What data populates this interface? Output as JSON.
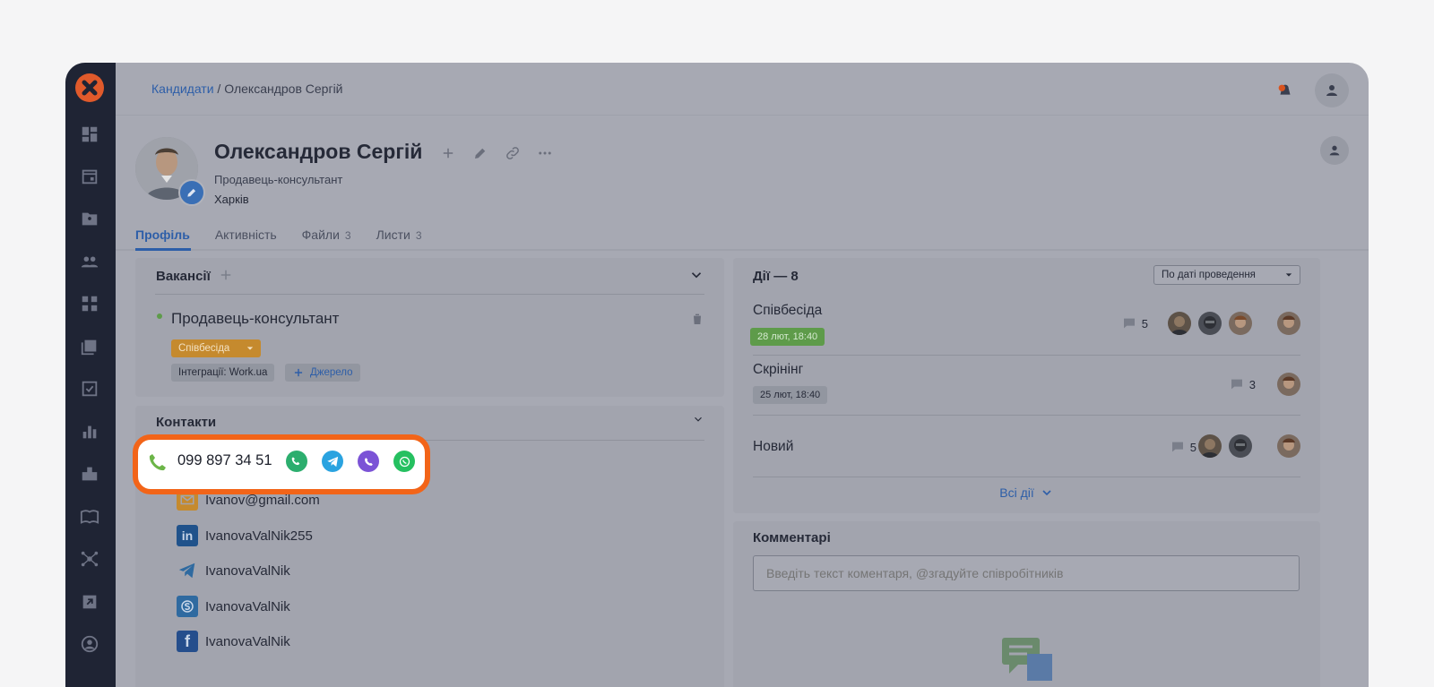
{
  "breadcrumb": {
    "root": "Кандидати",
    "separator": " / ",
    "current": "Олександров Сергій"
  },
  "candidate": {
    "name": "Олександров Сергій",
    "position": "Продавець-консультант",
    "city": "Харків"
  },
  "tabs": [
    {
      "label": "Профіль",
      "count": ""
    },
    {
      "label": "Активність",
      "count": ""
    },
    {
      "label": "Файли",
      "count": "3"
    },
    {
      "label": "Листи",
      "count": "3"
    }
  ],
  "vacancies": {
    "title": "Вакансії",
    "item": {
      "label": "Продавець-консультант",
      "stage": "Співбесіда",
      "integration": "Інтеграції: Work.ua",
      "source_button": "Джерело"
    }
  },
  "contacts": {
    "title": "Контакти",
    "phone": "099 897 34 51",
    "email": "Ivanov@gmail.com",
    "linkedin": "IvanovaValNik255",
    "telegram": "IvanovaValNik",
    "skype": "IvanovaValNik",
    "facebook": "IvanovaValNik"
  },
  "actions": {
    "title": "Дії — 8",
    "sort": "По даті проведення",
    "items": [
      {
        "title": "Співбесіда",
        "date": "28 лют, 18:40",
        "comments": "5"
      },
      {
        "title": "Скрінінг",
        "date": "25 лют, 18:40",
        "comments": "3"
      },
      {
        "title": "Новий",
        "date": "",
        "comments": "5"
      }
    ],
    "all": "Всі дії"
  },
  "comments": {
    "title": "Комментарі",
    "placeholder": "Введіть текст коментаря, @згадуйте співробітників"
  },
  "colors": {
    "accent": "#2d5ea8",
    "highlight": "#f26418",
    "stage": "#c58a2e",
    "date_green": "#5e9b4a",
    "sidebar": "#1f2434"
  }
}
